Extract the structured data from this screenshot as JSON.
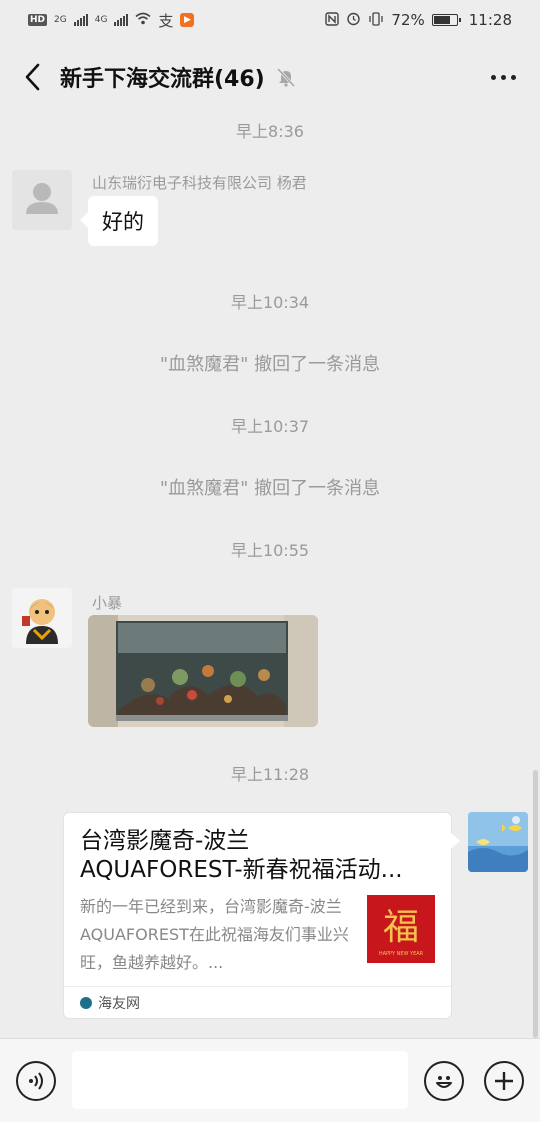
{
  "status_bar": {
    "hd_label": "HD",
    "net_1": "2G",
    "net_2": "4G",
    "battery_text": "72%",
    "battery_level": 0.72,
    "time": "11:28",
    "icons": [
      "hd-icon",
      "signal-icon",
      "signal-icon",
      "wifi-icon",
      "alipay-icon",
      "app-notification-icon",
      "nfc-icon",
      "alarm-icon",
      "vibrate-icon",
      "battery-icon"
    ]
  },
  "header": {
    "title": "新手下海交流群(46)",
    "icons": [
      "back-arrow-icon",
      "mute-bell-icon",
      "more-dots-icon"
    ]
  },
  "messages": {
    "time_1": "早上8:36",
    "msg1_sender": "山东瑞衍电子科技有限公司 杨君",
    "msg1_text": "好的",
    "time_2": "早上10:34",
    "recall_1": "\"血煞魔君\" 撤回了一条消息",
    "time_3": "早上10:37",
    "recall_2": "\"血煞魔君\" 撤回了一条消息",
    "time_4": "早上10:55",
    "msg2_sender": "小暴",
    "time_5": "早上11:28",
    "card": {
      "title": "台湾影魔奇-波兰AQUAFOREST-新春祝福活动...",
      "title_line1": "台湾影魔奇-波兰",
      "title_line2": "AQUAFOREST-新春祝福活动...",
      "desc": "新的一年已经到来，台湾影魔奇-波兰AQUAFOREST在此祝福海友们事业兴旺，鱼越养越好。...",
      "thumb_char": "福",
      "thumb_sub": "HAPPY NEW YEAR",
      "source": "海友网"
    }
  },
  "colors": {
    "background": "#ededed",
    "bubble": "#ffffff",
    "meta_text": "#9a9a9a",
    "thumb_red": "#c8161d"
  }
}
